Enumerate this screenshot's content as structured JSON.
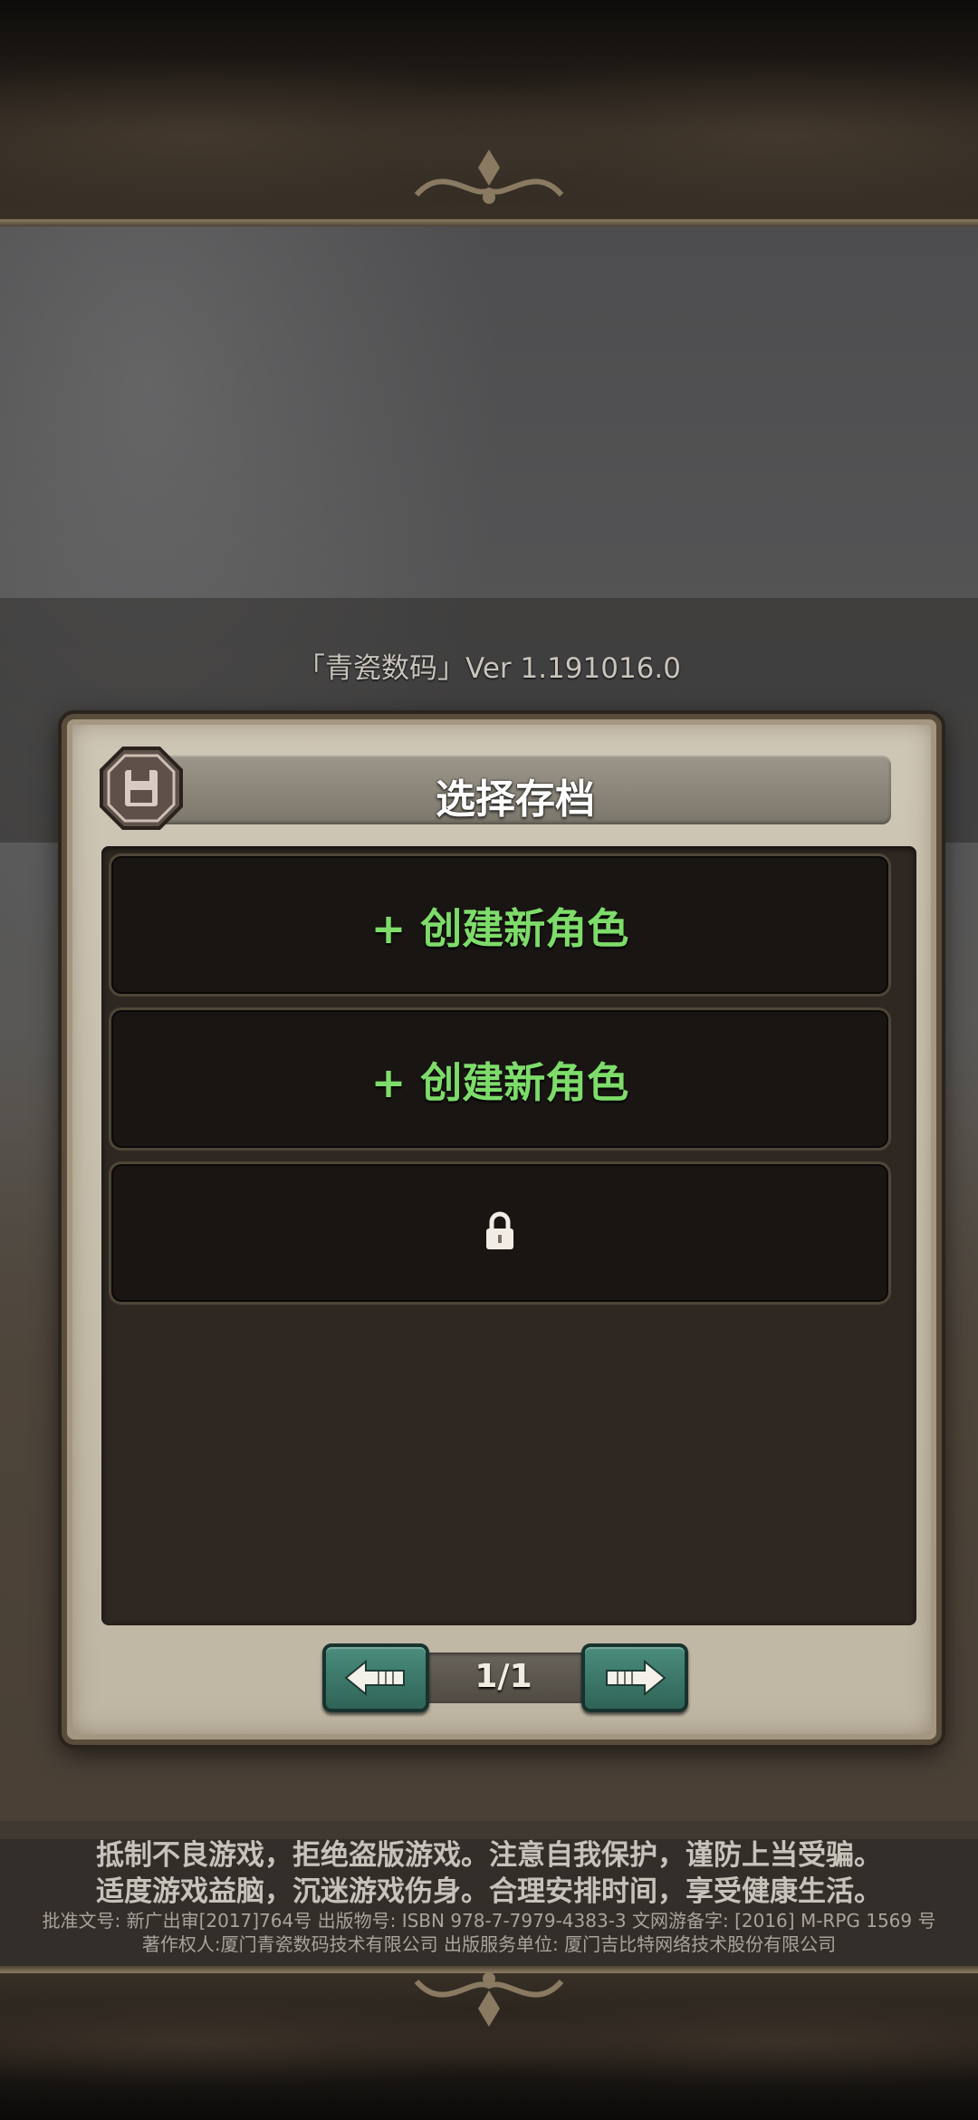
{
  "version_text": "「青瓷数码」Ver 1.191016.0",
  "dialog": {
    "title": "选择存档",
    "title_icon": "floppy-disk-icon",
    "slots": [
      {
        "label": "+ 创建新角色",
        "state": "empty"
      },
      {
        "label": "+ 创建新角色",
        "state": "empty"
      },
      {
        "label": "",
        "state": "locked",
        "icon": "lock-icon"
      }
    ],
    "pager": {
      "page": "1/1",
      "prev_icon": "arrow-left-icon",
      "next_icon": "arrow-right-icon"
    }
  },
  "notice": {
    "line1": "抵制不良游戏，拒绝盗版游戏。注意自我保护，谨防上当受骗。",
    "line2": "适度游戏益脑，沉迷游戏伤身。合理安排时间，享受健康生活。",
    "legal1": "批准文号: 新广出审[2017]764号 出版物号: ISBN 978-7-7979-4383-3 文网游备字: [2016] M-RPG 1569 号",
    "legal2": "著作权人:厦门青瓷数码技术有限公司 出版服务单位: 厦门吉比特网络技术股份有限公司"
  },
  "colors": {
    "accent_green": "#7edc6a",
    "button_teal": "#3f7a6b",
    "panel_beige": "#c7bfae"
  }
}
